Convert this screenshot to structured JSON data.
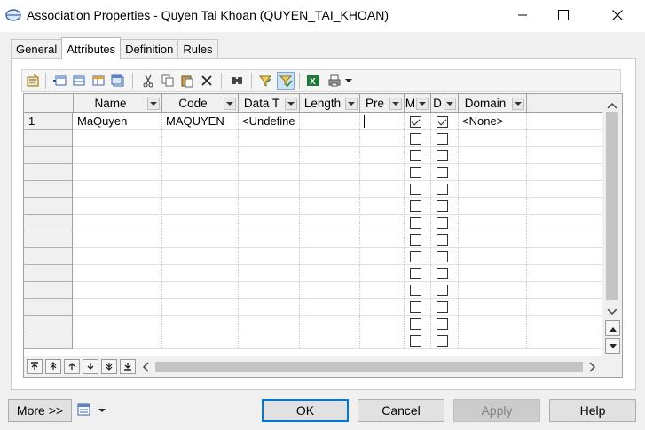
{
  "window": {
    "title": "Association Properties - Quyen Tai Khoan (QUYEN_TAI_KHOAN)",
    "icon": "association-icon"
  },
  "tabs": [
    {
      "label": "General",
      "active": false
    },
    {
      "label": "Attributes",
      "active": true
    },
    {
      "label": "Definition",
      "active": false
    },
    {
      "label": "Rules",
      "active": false
    }
  ],
  "toolbar": {
    "icons": [
      "properties-icon",
      "insert-row-icon",
      "add-row-icon",
      "add-attributes-icon",
      "reuse-attributes-icon",
      "cut-icon",
      "copy-icon",
      "paste-icon",
      "delete-icon",
      "find-icon",
      "filter-icon",
      "customize-columns-icon",
      "excel-export-icon",
      "print-icon",
      "dropdown-arrow-icon"
    ]
  },
  "grid": {
    "columns": [
      "Name",
      "Code",
      "Data T",
      "Length",
      "Pre",
      "M",
      "D",
      "Domain"
    ],
    "rows": [
      {
        "num": "1",
        "name": "MaQuyen",
        "code": "MAQUYEN",
        "datatype": "<Undefine",
        "length": "",
        "precision": "",
        "mandatory": true,
        "displayed": true,
        "domain": "<None>"
      }
    ],
    "empty_row_count": 13
  },
  "buttons": {
    "more": "More >>",
    "ok": "OK",
    "cancel": "Cancel",
    "apply": "Apply",
    "help": "Help"
  },
  "colors": {
    "accent": "#0078d7",
    "excel_green": "#1d7a3a"
  }
}
